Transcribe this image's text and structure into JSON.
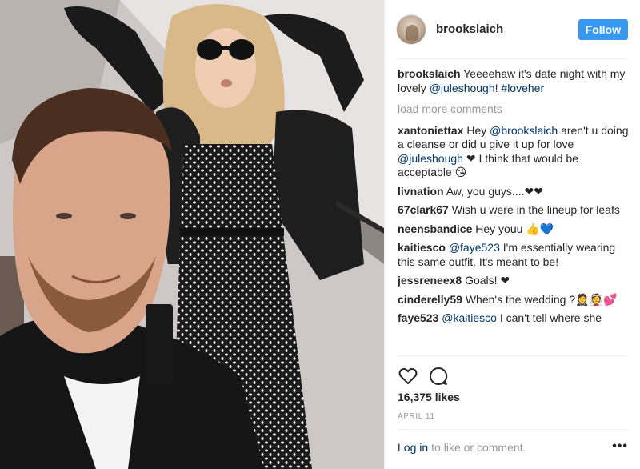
{
  "post": {
    "author": "brookslaich",
    "follow_label": "Follow",
    "caption": {
      "user": "brookslaich",
      "parts": [
        {
          "t": "Yeeeehaw it's date night with my lovely ",
          "k": "text"
        },
        {
          "t": "@juleshough",
          "k": "mention"
        },
        {
          "t": "! ",
          "k": "text"
        },
        {
          "t": "#loveher",
          "k": "tag"
        }
      ]
    },
    "load_more": "load more comments",
    "comments": [
      {
        "user": "xantoniettax",
        "parts": [
          {
            "t": "Hey ",
            "k": "text"
          },
          {
            "t": "@brookslaich",
            "k": "mention"
          },
          {
            "t": " aren't u doing a cleanse or did u give it up for love ",
            "k": "text"
          },
          {
            "t": "@juleshough",
            "k": "mention"
          },
          {
            "t": " ❤ I think that would be acceptable 😘",
            "k": "text"
          }
        ]
      },
      {
        "user": "livnation",
        "parts": [
          {
            "t": "Aw, you guys....❤❤",
            "k": "text"
          }
        ]
      },
      {
        "user": "67clark67",
        "parts": [
          {
            "t": "Wish u were in the lineup for leafs",
            "k": "text"
          }
        ]
      },
      {
        "user": "neensbandice",
        "parts": [
          {
            "t": "Hey youu 👍💙",
            "k": "text"
          }
        ]
      },
      {
        "user": "kaitiesco",
        "parts": [
          {
            "t": "@faye523",
            "k": "mention"
          },
          {
            "t": " I'm essentially wearing this same outfit. It's meant to be!",
            "k": "text"
          }
        ]
      },
      {
        "user": "jessreneex8",
        "parts": [
          {
            "t": "Goals! ❤",
            "k": "text"
          }
        ]
      },
      {
        "user": "cinderelly59",
        "parts": [
          {
            "t": "When's the wedding ?🤵👰💕",
            "k": "text"
          }
        ]
      },
      {
        "user": "faye523",
        "parts": [
          {
            "t": "@kaitiesco",
            "k": "mention"
          },
          {
            "t": " I can't tell where she",
            "k": "text"
          }
        ]
      }
    ],
    "likes": "16,375 likes",
    "date": "APRIL 11",
    "footer": {
      "login": "Log in",
      "rest": "to like or comment.",
      "more": "•••"
    },
    "icons": {
      "like": "heart-outline-icon",
      "comment": "comment-bubble-icon"
    },
    "colors": {
      "follow_bg": "#3897f0",
      "link": "#003569",
      "muted": "#999999"
    }
  }
}
